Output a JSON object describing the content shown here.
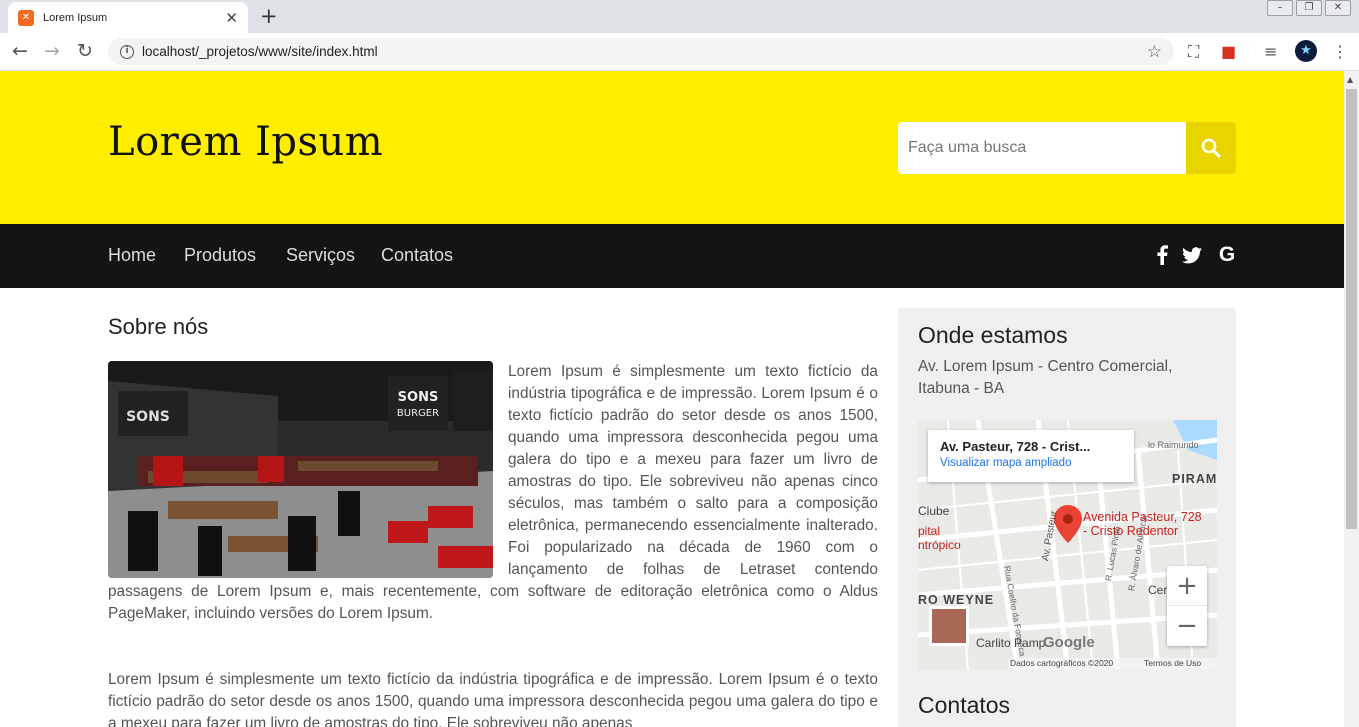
{
  "browser": {
    "tab_title": "Lorem Ipsum",
    "url": "localhost/_projetos/www/site/index.html"
  },
  "site": {
    "logo": "Lorem Ipsum",
    "search_placeholder": "Faça uma busca",
    "nav": [
      "Home",
      "Produtos",
      "Serviços",
      "Contatos"
    ],
    "social_icons": [
      "facebook-icon",
      "twitter-icon",
      "google-icon"
    ],
    "colors": {
      "header": "#ffee00",
      "navbar": "#141414",
      "search_button": "#e8d500"
    }
  },
  "main": {
    "title": "Sobre nós",
    "paragraph1": "Lorem Ipsum é simplesmente um texto fictício da indústria tipográfica e de impressão. Lorem Ipsum é o texto fictício padrão do setor desde os anos 1500, quando uma impressora desconhecida pegou uma galera do tipo e a mexeu para fazer um livro de amostras do tipo. Ele sobreviveu não apenas cinco séculos, mas também o salto para a composição eletrônica, permanecendo essencialmente inalterado. Foi popularizado na década de 1960 com o lançamento de folhas de Letraset contendo passagens de Lorem Ipsum e, mais recentemente, com software de editoração eletrônica como o Aldus PageMaker, incluindo versões do Lorem Ipsum.",
    "paragraph2": "Lorem Ipsum é simplesmente um texto fictício da indústria tipográfica e de impressão. Lorem Ipsum é o texto fictício padrão do setor desde os anos 1500, quando uma impressora desconhecida pegou uma galera do tipo e a mexeu para fazer um livro de amostras do tipo. Ele sobreviveu não apenas"
  },
  "sidebar": {
    "location_title": "Onde estamos",
    "address": "Av. Lorem Ipsum - Centro Comercial, Itabuna - BA",
    "contacts_title": "Contatos",
    "map": {
      "card_title": "Av. Pasteur, 728 - Crist...",
      "card_link": "Visualizar mapa ampliado",
      "pin_label_line1": "Avenida Pasteur, 728",
      "pin_label_line2": "- Cristo Redentor",
      "labels": {
        "pirambu": "PIRAMBU",
        "clube": "Clube",
        "pital": "pital",
        "ntropico": "ntrópico",
        "ro_weyne": "RO WEYNE",
        "raimundo": "lo Raimundo",
        "av_pasteur": "Av. Pasteur",
        "coelho": "Rua Coelho da Fonseca",
        "lucas": "R. Lucas Pinto",
        "alvaro": "R. Álvaro de Alencar",
        "carlito": "Carlito Pamp",
        "cer": "Cer",
        "google": "Google",
        "attribution": "Dados cartográficos ©2020",
        "terms": "Termos de Uso"
      }
    }
  }
}
